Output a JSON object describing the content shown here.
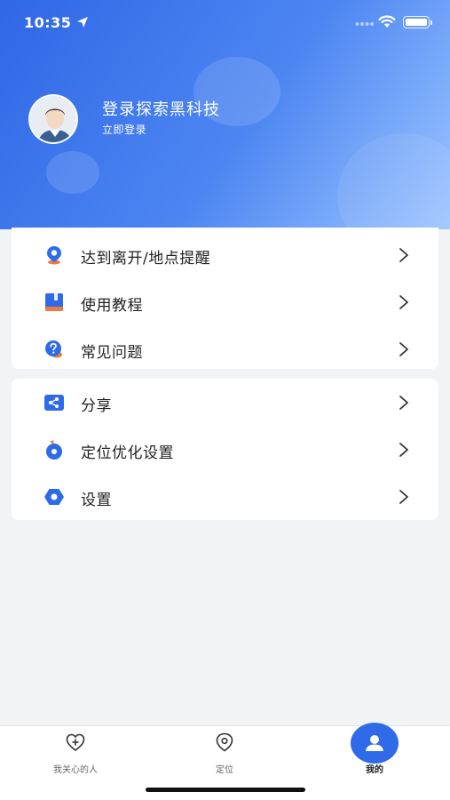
{
  "status_bar": {
    "time": "10:35"
  },
  "profile": {
    "title": "登录探索黑科技",
    "login_link": "立即登录"
  },
  "menu_group_1": [
    {
      "label": "达到离开/地点提醒",
      "icon": "location-reminder-icon"
    },
    {
      "label": "使用教程",
      "icon": "tutorial-book-icon"
    },
    {
      "label": "常见问题",
      "icon": "faq-question-icon"
    }
  ],
  "menu_group_2": [
    {
      "label": "分享",
      "icon": "share-icon"
    },
    {
      "label": "定位优化设置",
      "icon": "location-optimize-icon"
    },
    {
      "label": "设置",
      "icon": "settings-icon"
    }
  ],
  "tabbar": {
    "tabs": [
      {
        "label": "我关心的人",
        "icon": "heart-plus-icon"
      },
      {
        "label": "定位",
        "icon": "location-pin-icon"
      },
      {
        "label": "我的",
        "icon": "profile-icon",
        "active": true
      }
    ]
  },
  "colors": {
    "accent": "#2f6be8",
    "header_gradient_start": "#2f67e6",
    "header_gradient_end": "#9ec6ff",
    "background": "#f2f3f5",
    "orange_accent": "#f07b3f"
  }
}
